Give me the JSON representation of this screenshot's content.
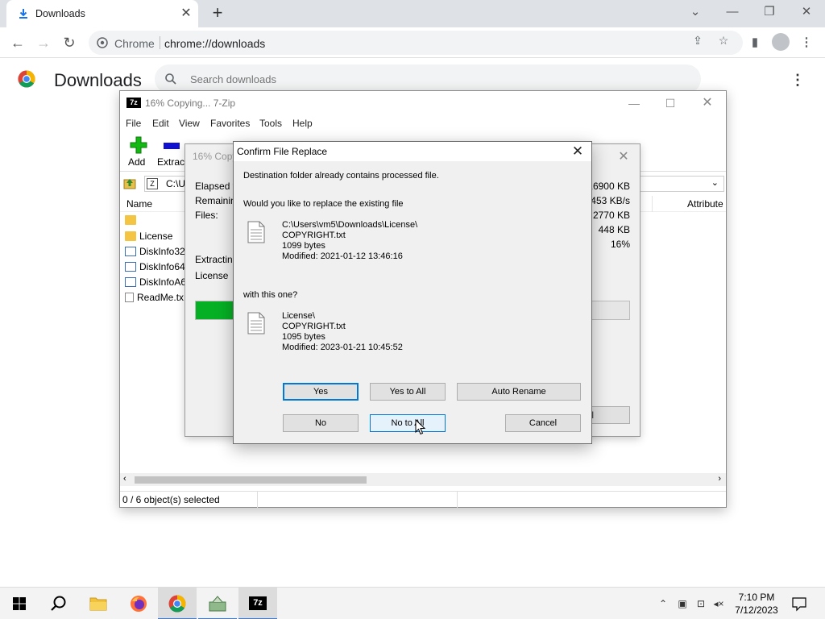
{
  "chrome": {
    "tab_title": "Downloads",
    "scheme_label": "Chrome",
    "url": "chrome://downloads",
    "page_title": "Downloads",
    "search_placeholder": "Search downloads"
  },
  "zip_window": {
    "title": "16% Copying... 7-Zip",
    "menu": [
      "File",
      "Edit",
      "View",
      "Favorites",
      "Tools",
      "Help"
    ],
    "toolbar": {
      "add": "Add",
      "extract": "Extract"
    },
    "address": "C:\\U",
    "columns": {
      "name": "Name",
      "attributes": "Attribute"
    },
    "files": [
      "",
      "License",
      "DiskInfo32.",
      "DiskInfo64.",
      "DiskInfoA6",
      "ReadMe.tx"
    ],
    "status": "0 / 6 object(s) selected"
  },
  "progress_dialog": {
    "title": "16% Copy",
    "elapsed_label": "Elapsed ti",
    "remaining_label": "Remaining",
    "files_label": "Files:",
    "extracting_label": "Extracting",
    "current_item": "License",
    "total_size": "16900 KB",
    "speed": "453 KB/s",
    "processed": "2770 KB",
    "compressed": "448 KB",
    "percent": "16%",
    "button_label": "l",
    "progress_fraction": 0.16
  },
  "confirm_dialog": {
    "title": "Confirm File Replace",
    "message": "Destination folder already contains processed file.",
    "question": "Would you like to replace the existing file",
    "existing": {
      "path": "C:\\Users\\vm5\\Downloads\\License\\",
      "name": "COPYRIGHT.txt",
      "size": "1099 bytes",
      "modified": "Modified: 2021-01-12 13:46:16"
    },
    "with_label": "with this one?",
    "new": {
      "path": "License\\",
      "name": "COPYRIGHT.txt",
      "size": "1095 bytes",
      "modified": "Modified: 2023-01-21 10:45:52"
    },
    "buttons": {
      "yes": "Yes",
      "yes_to_all": "Yes to All",
      "auto_rename": "Auto Rename",
      "no": "No",
      "no_to_all": "No to All",
      "cancel": "Cancel"
    }
  },
  "taskbar": {
    "time": "7:10 PM",
    "date": "7/12/2023"
  },
  "colors": {
    "progress_green": "#06b025",
    "focus_blue": "#0078d7",
    "taskbar_bg": "#f3f3f3"
  }
}
